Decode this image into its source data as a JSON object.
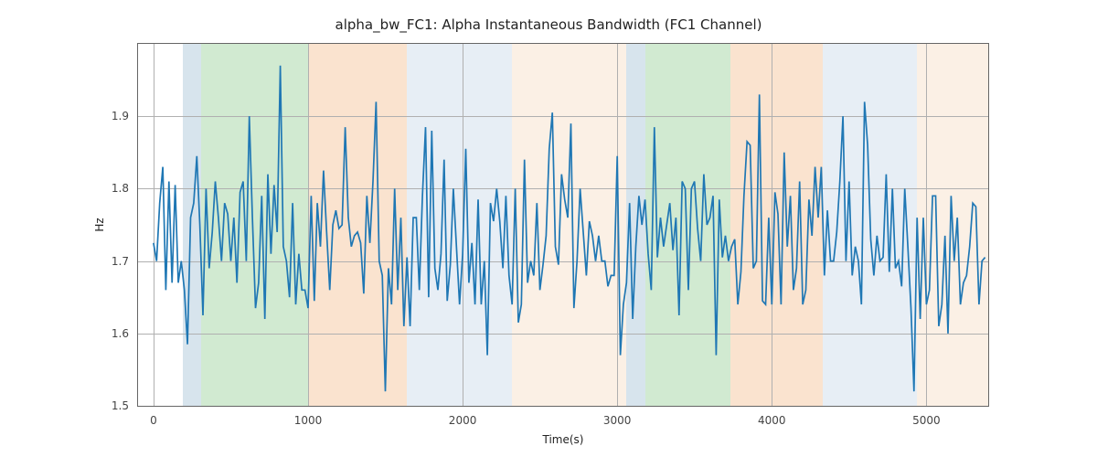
{
  "chart_data": {
    "type": "line",
    "title": "alpha_bw_FC1: Alpha Instantaneous Bandwidth (FC1 Channel)",
    "xlabel": "Time(s)",
    "ylabel": "Hz",
    "xlim": [
      -100,
      5400
    ],
    "ylim": [
      1.5,
      2.0
    ],
    "xticks": [
      0,
      1000,
      2000,
      3000,
      4000,
      5000
    ],
    "yticks": [
      1.5,
      1.6,
      1.7,
      1.8,
      1.9
    ],
    "regions": [
      {
        "x0": 190,
        "x1": 310,
        "color": "#6f9fbf"
      },
      {
        "x0": 310,
        "x1": 1000,
        "color": "#58b258"
      },
      {
        "x0": 1000,
        "x1": 1640,
        "color": "#ec9c53"
      },
      {
        "x0": 1640,
        "x1": 2320,
        "color": "#a9c2db"
      },
      {
        "x0": 2320,
        "x1": 3060,
        "color": "#f2c9a0"
      },
      {
        "x0": 3060,
        "x1": 3180,
        "color": "#6f9fbf"
      },
      {
        "x0": 3180,
        "x1": 3730,
        "color": "#58b258"
      },
      {
        "x0": 3730,
        "x1": 4330,
        "color": "#ec9c53"
      },
      {
        "x0": 4330,
        "x1": 4940,
        "color": "#a9c2db"
      },
      {
        "x0": 4940,
        "x1": 5400,
        "color": "#f2c9a0"
      }
    ],
    "x": [
      0,
      20,
      40,
      60,
      80,
      100,
      120,
      140,
      160,
      180,
      200,
      220,
      240,
      260,
      280,
      300,
      320,
      340,
      360,
      380,
      400,
      420,
      440,
      460,
      480,
      500,
      520,
      540,
      560,
      580,
      600,
      620,
      640,
      660,
      680,
      700,
      720,
      740,
      760,
      780,
      800,
      820,
      840,
      860,
      880,
      900,
      920,
      940,
      960,
      980,
      1000,
      1020,
      1040,
      1060,
      1080,
      1100,
      1120,
      1140,
      1160,
      1180,
      1200,
      1220,
      1240,
      1260,
      1280,
      1300,
      1320,
      1340,
      1360,
      1380,
      1400,
      1420,
      1440,
      1460,
      1480,
      1500,
      1520,
      1540,
      1560,
      1580,
      1600,
      1620,
      1640,
      1660,
      1680,
      1700,
      1720,
      1740,
      1760,
      1780,
      1800,
      1820,
      1840,
      1860,
      1880,
      1900,
      1920,
      1940,
      1960,
      1980,
      2000,
      2020,
      2040,
      2060,
      2080,
      2100,
      2120,
      2140,
      2160,
      2180,
      2200,
      2220,
      2240,
      2260,
      2280,
      2300,
      2320,
      2340,
      2360,
      2380,
      2400,
      2420,
      2440,
      2460,
      2480,
      2500,
      2520,
      2540,
      2560,
      2580,
      2600,
      2620,
      2640,
      2660,
      2680,
      2700,
      2720,
      2740,
      2760,
      2780,
      2800,
      2820,
      2840,
      2860,
      2880,
      2900,
      2920,
      2940,
      2960,
      2980,
      3000,
      3020,
      3040,
      3060,
      3080,
      3100,
      3120,
      3140,
      3160,
      3180,
      3200,
      3220,
      3240,
      3260,
      3280,
      3300,
      3320,
      3340,
      3360,
      3380,
      3400,
      3420,
      3440,
      3460,
      3480,
      3500,
      3520,
      3540,
      3560,
      3580,
      3600,
      3620,
      3640,
      3660,
      3680,
      3700,
      3720,
      3740,
      3760,
      3780,
      3800,
      3820,
      3840,
      3860,
      3880,
      3900,
      3920,
      3940,
      3960,
      3980,
      4000,
      4020,
      4040,
      4060,
      4080,
      4100,
      4120,
      4140,
      4160,
      4180,
      4200,
      4220,
      4240,
      4260,
      4280,
      4300,
      4320,
      4340,
      4360,
      4380,
      4400,
      4420,
      4440,
      4460,
      4480,
      4500,
      4520,
      4540,
      4560,
      4580,
      4600,
      4620,
      4640,
      4660,
      4680,
      4700,
      4720,
      4740,
      4760,
      4780,
      4800,
      4820,
      4840,
      4860,
      4880,
      4900,
      4920,
      4940,
      4960,
      4980,
      5000,
      5020,
      5040,
      5060,
      5080,
      5100,
      5120,
      5140,
      5160,
      5180,
      5200,
      5220,
      5240,
      5260,
      5280,
      5300,
      5320,
      5340,
      5360,
      5380
    ],
    "y": [
      1.725,
      1.7,
      1.78,
      1.83,
      1.66,
      1.81,
      1.67,
      1.805,
      1.67,
      1.7,
      1.66,
      1.585,
      1.76,
      1.78,
      1.845,
      1.75,
      1.625,
      1.8,
      1.69,
      1.74,
      1.81,
      1.76,
      1.7,
      1.78,
      1.765,
      1.7,
      1.76,
      1.67,
      1.795,
      1.81,
      1.7,
      1.9,
      1.76,
      1.635,
      1.67,
      1.79,
      1.62,
      1.82,
      1.71,
      1.805,
      1.74,
      1.97,
      1.72,
      1.7,
      1.65,
      1.78,
      1.64,
      1.71,
      1.66,
      1.66,
      1.635,
      1.79,
      1.645,
      1.78,
      1.72,
      1.825,
      1.74,
      1.66,
      1.75,
      1.77,
      1.745,
      1.75,
      1.885,
      1.76,
      1.72,
      1.735,
      1.74,
      1.725,
      1.655,
      1.79,
      1.725,
      1.81,
      1.92,
      1.7,
      1.68,
      1.52,
      1.69,
      1.64,
      1.8,
      1.66,
      1.76,
      1.61,
      1.705,
      1.61,
      1.76,
      1.76,
      1.66,
      1.79,
      1.885,
      1.65,
      1.88,
      1.69,
      1.66,
      1.71,
      1.84,
      1.645,
      1.695,
      1.8,
      1.72,
      1.64,
      1.71,
      1.855,
      1.67,
      1.725,
      1.64,
      1.785,
      1.64,
      1.7,
      1.57,
      1.78,
      1.755,
      1.8,
      1.755,
      1.69,
      1.79,
      1.68,
      1.64,
      1.8,
      1.615,
      1.64,
      1.84,
      1.67,
      1.7,
      1.68,
      1.78,
      1.66,
      1.695,
      1.735,
      1.855,
      1.905,
      1.72,
      1.695,
      1.82,
      1.785,
      1.76,
      1.89,
      1.635,
      1.7,
      1.8,
      1.74,
      1.68,
      1.755,
      1.735,
      1.7,
      1.735,
      1.7,
      1.7,
      1.665,
      1.68,
      1.68,
      1.845,
      1.57,
      1.64,
      1.67,
      1.78,
      1.62,
      1.72,
      1.79,
      1.75,
      1.785,
      1.71,
      1.66,
      1.885,
      1.705,
      1.76,
      1.72,
      1.75,
      1.78,
      1.715,
      1.76,
      1.625,
      1.81,
      1.8,
      1.66,
      1.8,
      1.81,
      1.745,
      1.7,
      1.82,
      1.75,
      1.76,
      1.79,
      1.57,
      1.785,
      1.705,
      1.735,
      1.7,
      1.72,
      1.73,
      1.64,
      1.685,
      1.79,
      1.865,
      1.86,
      1.69,
      1.7,
      1.93,
      1.645,
      1.64,
      1.76,
      1.64,
      1.795,
      1.765,
      1.64,
      1.85,
      1.72,
      1.79,
      1.66,
      1.69,
      1.81,
      1.64,
      1.66,
      1.785,
      1.735,
      1.83,
      1.76,
      1.83,
      1.68,
      1.77,
      1.7,
      1.7,
      1.74,
      1.81,
      1.9,
      1.7,
      1.81,
      1.68,
      1.72,
      1.7,
      1.64,
      1.92,
      1.86,
      1.73,
      1.68,
      1.735,
      1.7,
      1.705,
      1.82,
      1.685,
      1.8,
      1.69,
      1.7,
      1.665,
      1.8,
      1.72,
      1.635,
      1.52,
      1.76,
      1.62,
      1.76,
      1.64,
      1.66,
      1.79,
      1.79,
      1.61,
      1.64,
      1.735,
      1.6,
      1.79,
      1.7,
      1.76,
      1.64,
      1.67,
      1.68,
      1.72,
      1.78,
      1.775,
      1.64,
      1.7,
      1.705
    ]
  }
}
